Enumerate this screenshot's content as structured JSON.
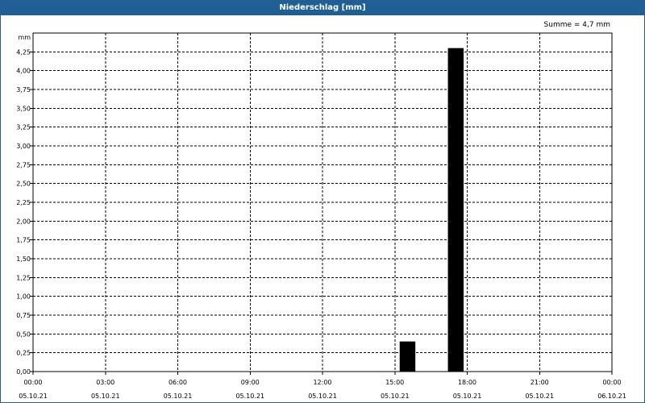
{
  "title": "Niederschlag [mm]",
  "summary": "Summe = 4,7 mm",
  "colors": {
    "titlebar": "#1f5f96",
    "bar": "#000000",
    "grid": "#000000"
  },
  "chart_data": {
    "type": "bar",
    "ylabel": "mm",
    "ylim": [
      0,
      4.5
    ],
    "yticks": [
      "0,00",
      "0,25",
      "0,50",
      "0,75",
      "1,00",
      "1,25",
      "1,50",
      "1,75",
      "2,00",
      "2,25",
      "2,50",
      "2,75",
      "3,00",
      "3,25",
      "3,50",
      "3,75",
      "4,00",
      "4,25"
    ],
    "xlim_hours": [
      0,
      24
    ],
    "xticks": [
      {
        "time": "00:00",
        "date": "05.10.21"
      },
      {
        "time": "03:00",
        "date": "05.10.21"
      },
      {
        "time": "06:00",
        "date": "05.10.21"
      },
      {
        "time": "09:00",
        "date": "05.10.21"
      },
      {
        "time": "12:00",
        "date": "05.10.21"
      },
      {
        "time": "15:00",
        "date": "05.10.21"
      },
      {
        "time": "18:00",
        "date": "05.10.21"
      },
      {
        "time": "21:00",
        "date": "05.10.21"
      },
      {
        "time": "00:00",
        "date": "06.10.21"
      }
    ],
    "grid": true,
    "bars": [
      {
        "start_hour": 15.2,
        "end_hour": 15.85,
        "value": 0.4
      },
      {
        "start_hour": 17.2,
        "end_hour": 17.85,
        "value": 4.3
      }
    ]
  }
}
